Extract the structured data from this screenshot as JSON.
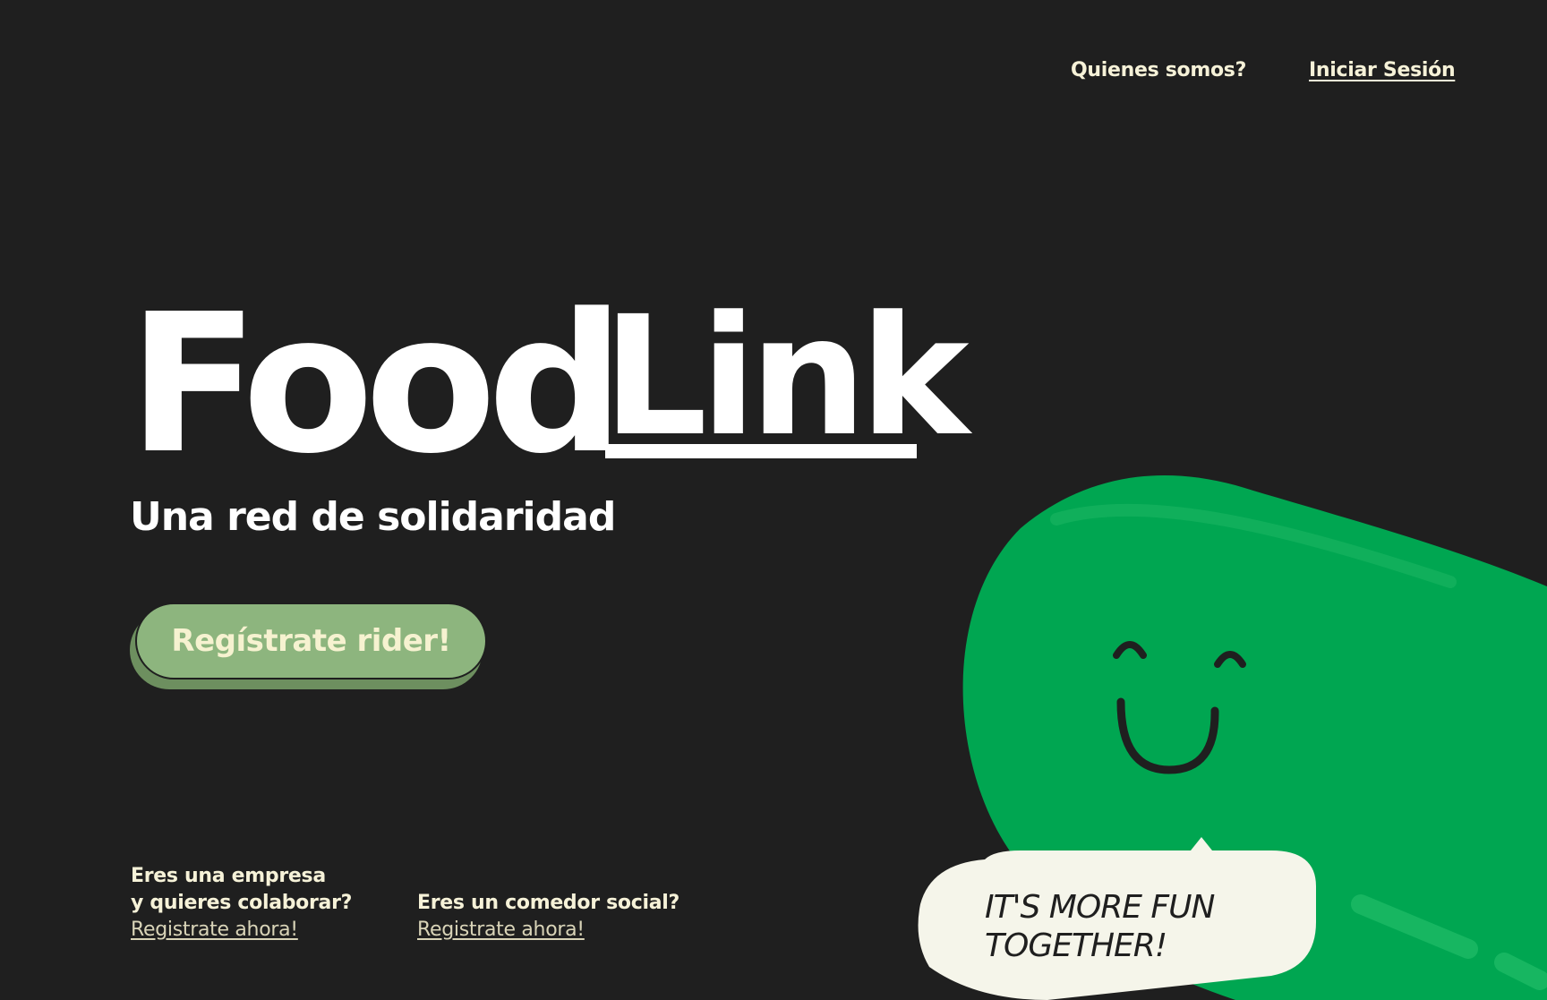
{
  "nav": {
    "about_label": "Quienes somos?",
    "login_label": "Iniciar Sesión"
  },
  "hero": {
    "logo_word1": "Food",
    "logo_word2": "Link",
    "subtitle": "Una red de solidaridad",
    "cta_label": "Regístrate rider!"
  },
  "info": {
    "company_line1": "Eres una empresa",
    "company_line2": "y quieres colaborar?",
    "company_link": "Registrate ahora!",
    "canteen_line1": "Eres un comedor social?",
    "canteen_link": "Registrate ahora!"
  },
  "mascot": {
    "speech": "IT'S MORE FUN TOGETHER!",
    "body_color": "#00a651",
    "bubble_color": "#f5f5ea"
  },
  "colors": {
    "background": "#1f1f1f",
    "text_cream": "#f6f2d8",
    "cta_green": "#8db57e"
  }
}
